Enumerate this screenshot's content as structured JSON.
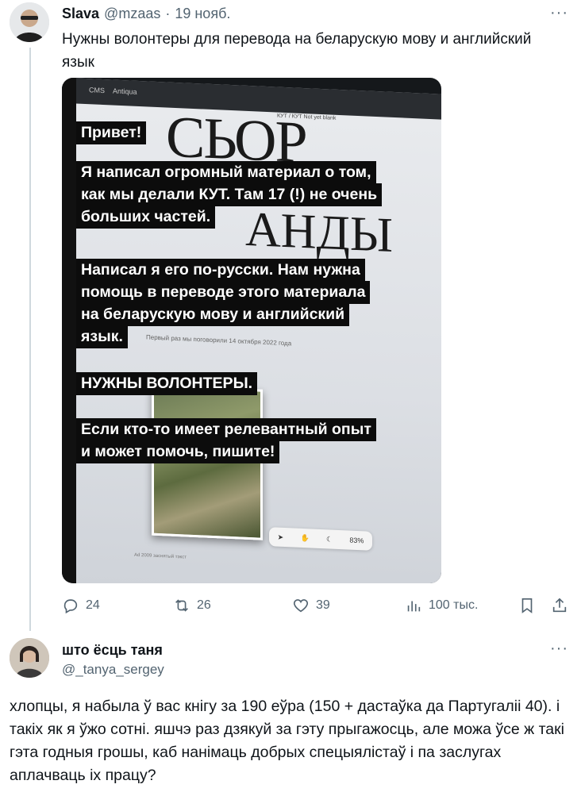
{
  "tweet1": {
    "author_name": "Slava",
    "author_handle": "@mzaas",
    "separator": "·",
    "date": "19 нояб.",
    "more": "···",
    "text": "Нужны волонтеры для перевода на беларускую мову и английский язык",
    "media": {
      "screen": {
        "bar_items": [
          "CMS",
          "Antiqua"
        ],
        "tabs": "КУТ / КУТ   Not yet  blank",
        "title_1": "СЬОР",
        "title_2": "АНДЫ",
        "caption": "Первый раз мы поговорили 14 октября 2022 года",
        "zoom": "83%",
        "footer": "Ad 2009 заснятый тэкст"
      },
      "overlay": {
        "block1": [
          "Привет!"
        ],
        "block2": [
          "Я написал огромный материал о том,",
          "как мы делали КУТ. Там 17 (!) не очень",
          "больших частей."
        ],
        "block3": [
          "Написал я его по-русски. Нам нужна",
          "помощь в переводе этого материала",
          "на беларускую мову и английский",
          "язык."
        ],
        "block4": [
          "НУЖНЫ ВОЛОНТЕРЫ."
        ],
        "block5": [
          "Если кто-то имеет релевантный опыт",
          "и может помочь, пишите!"
        ]
      }
    },
    "actions": {
      "replies": "24",
      "retweets": "26",
      "likes": "39",
      "views": "100 тыс."
    }
  },
  "tweet2": {
    "author_name": "што ёсць таня",
    "author_handle": "@_tanya_sergey",
    "more": "···",
    "text": "хлопцы, я набыла ў вас кнігу за 190 еўра (150 + дастаўка да Партугаліі 40). і такіх як я ўжо сотні. яшчэ раз дзякуй за гэту прыгажосць, але можа ўсе ж такі гэта годныя грошы, каб нанімаць добрых спецыялістаў і па заслугах аплачваць іх працу?"
  },
  "colors": {
    "text_primary": "#0f1419",
    "text_secondary": "#536471",
    "thread_line": "#cfd9de",
    "overlay_bg": "#0c0c0c"
  },
  "icons": {
    "reply": "speech-bubble-icon",
    "retweet": "retweet-arrows-icon",
    "like": "heart-icon",
    "views": "bar-chart-icon",
    "bookmark": "bookmark-icon",
    "share": "share-upload-icon"
  }
}
